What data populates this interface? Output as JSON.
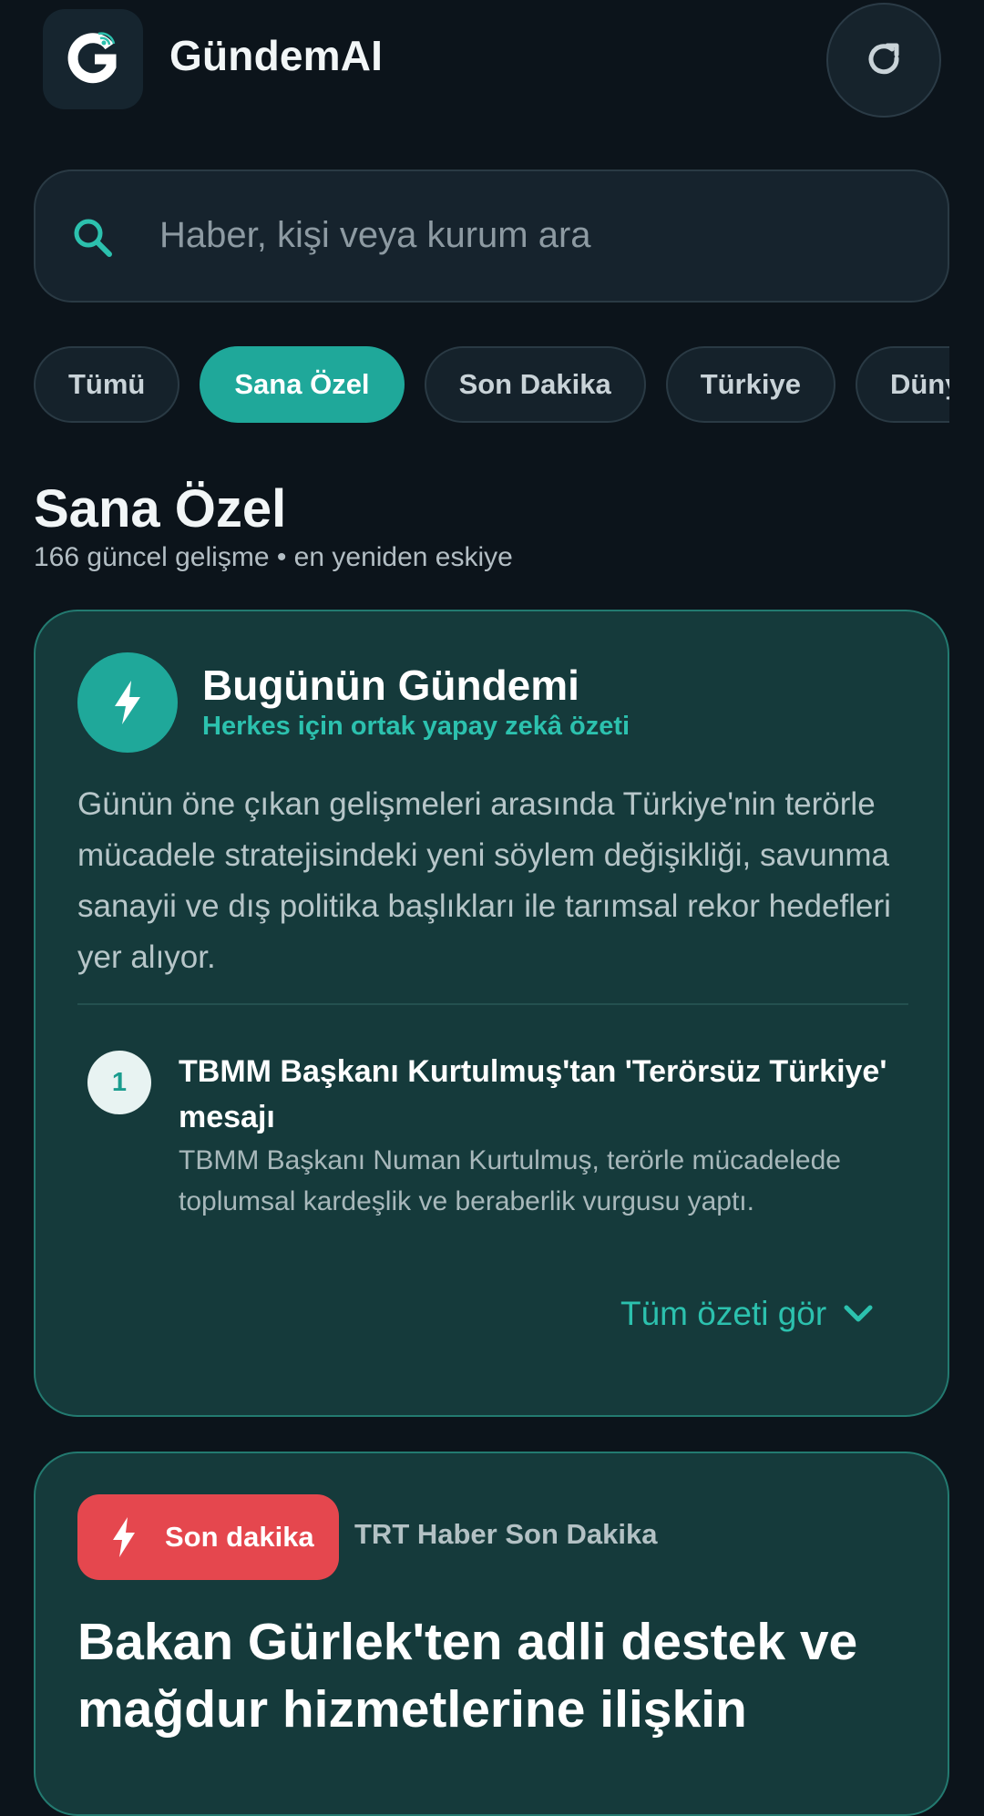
{
  "header": {
    "app_name": "GündemAI",
    "logo_letter": "G",
    "logo_icon": "g-logo-icon",
    "refresh_icon": "refresh-icon"
  },
  "search": {
    "placeholder": "Haber, kişi veya kurum ara",
    "value": "",
    "icon": "search-icon"
  },
  "tabs": [
    {
      "label": "Tümü",
      "active": false
    },
    {
      "label": "Sana Özel",
      "active": true
    },
    {
      "label": "Son Dakika",
      "active": false
    },
    {
      "label": "Türkiye",
      "active": false
    },
    {
      "label": "Dünya",
      "active": false
    }
  ],
  "section": {
    "title": "Sana Özel",
    "subtitle": "166 güncel gelişme • en yeniden eskiye"
  },
  "summary_card": {
    "icon": "bolt-icon",
    "title": "Bugünün Gündemi",
    "subtitle": "Herkes için ortak yapay zekâ özeti",
    "body": "Günün öne çıkan gelişmeleri arasında Türkiye'nin terörle mücadele stratejisindeki yeni söylem değişikliği, savunma sanayii ve dış politika başlıkları ile tarımsal rekor hedefleri yer alıyor.",
    "items": [
      {
        "number": "1",
        "title": "TBMM Başkanı Kurtulmuş'tan 'Terörsüz Türkiye' mesajı",
        "description": "TBMM Başkanı Numan Kurtulmuş, terörle mücadelede toplumsal kardeşlik ve beraberlik vurgusu yaptı."
      }
    ],
    "see_all_label": "Tüm özeti gör"
  },
  "news_card": {
    "badge_label": "Son dakika",
    "source": "TRT Haber Son Dakika",
    "title": "Bakan Gürlek'ten adli destek ve mağdur hizmetlerine ilişkin"
  },
  "colors": {
    "background": "#0c141b",
    "accent": "#1fa89a",
    "card_bg": "#153a3b",
    "badge_red": "#e5474e"
  }
}
